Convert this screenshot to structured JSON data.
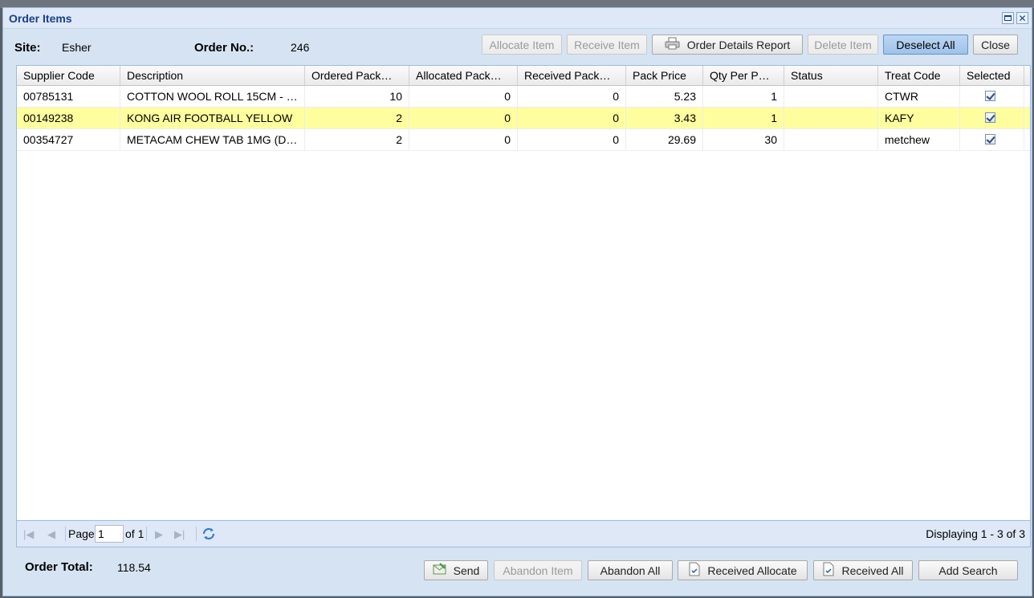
{
  "window": {
    "title": "Order Items"
  },
  "header": {
    "site_label": "Site:",
    "site_value": "Esher",
    "order_no_label": "Order No.:",
    "order_no_value": "246"
  },
  "toolbar": {
    "allocate_item": "Allocate Item",
    "receive_item": "Receive Item",
    "order_details_report": "Order Details Report",
    "delete_item": "Delete Item",
    "deselect_all": "Deselect All",
    "close": "Close"
  },
  "grid": {
    "columns": [
      "Supplier Code",
      "Description",
      "Ordered Pack…",
      "Allocated Pack…",
      "Received Pack…",
      "Pack Price",
      "Qty Per P…",
      "Status",
      "Treat Code",
      "Selected"
    ],
    "rows": [
      {
        "supplier_code": "00785131",
        "description": "COTTON WOOL ROLL 15CM - …",
        "ordered": "10",
        "allocated": "0",
        "received": "0",
        "pack_price": "5.23",
        "qty_per_pack": "1",
        "status": "",
        "treat_code": "CTWR",
        "selected": true,
        "highlighted": false
      },
      {
        "supplier_code": "00149238",
        "description": "KONG AIR FOOTBALL YELLOW",
        "ordered": "2",
        "allocated": "0",
        "received": "0",
        "pack_price": "3.43",
        "qty_per_pack": "1",
        "status": "",
        "treat_code": "KAFY",
        "selected": true,
        "highlighted": true
      },
      {
        "supplier_code": "00354727",
        "description": "METACAM CHEW TAB 1MG (D…",
        "ordered": "2",
        "allocated": "0",
        "received": "0",
        "pack_price": "29.69",
        "qty_per_pack": "30",
        "status": "",
        "treat_code": "metchew",
        "selected": true,
        "highlighted": false
      }
    ]
  },
  "pager": {
    "page_label": "Page",
    "page_value": "1",
    "of_label": "of 1",
    "displaying": "Displaying 1 - 3 of 3"
  },
  "footer": {
    "order_total_label": "Order Total:",
    "order_total_value": "118.54",
    "send": "Send",
    "abandon_item": "Abandon Item",
    "abandon_all": "Abandon All",
    "received_allocate": "Received Allocate",
    "received_all": "Received All",
    "add_search": "Add Search"
  },
  "colors": {
    "accent": "#15428b",
    "highlight_row": "#fffe9f",
    "panel": "#d6e3f2"
  },
  "icons": [
    "maximize-icon",
    "close-icon",
    "printer-icon",
    "first-page-icon",
    "prev-page-icon",
    "next-page-icon",
    "last-page-icon",
    "refresh-icon",
    "send-icon",
    "document-check-icon"
  ]
}
